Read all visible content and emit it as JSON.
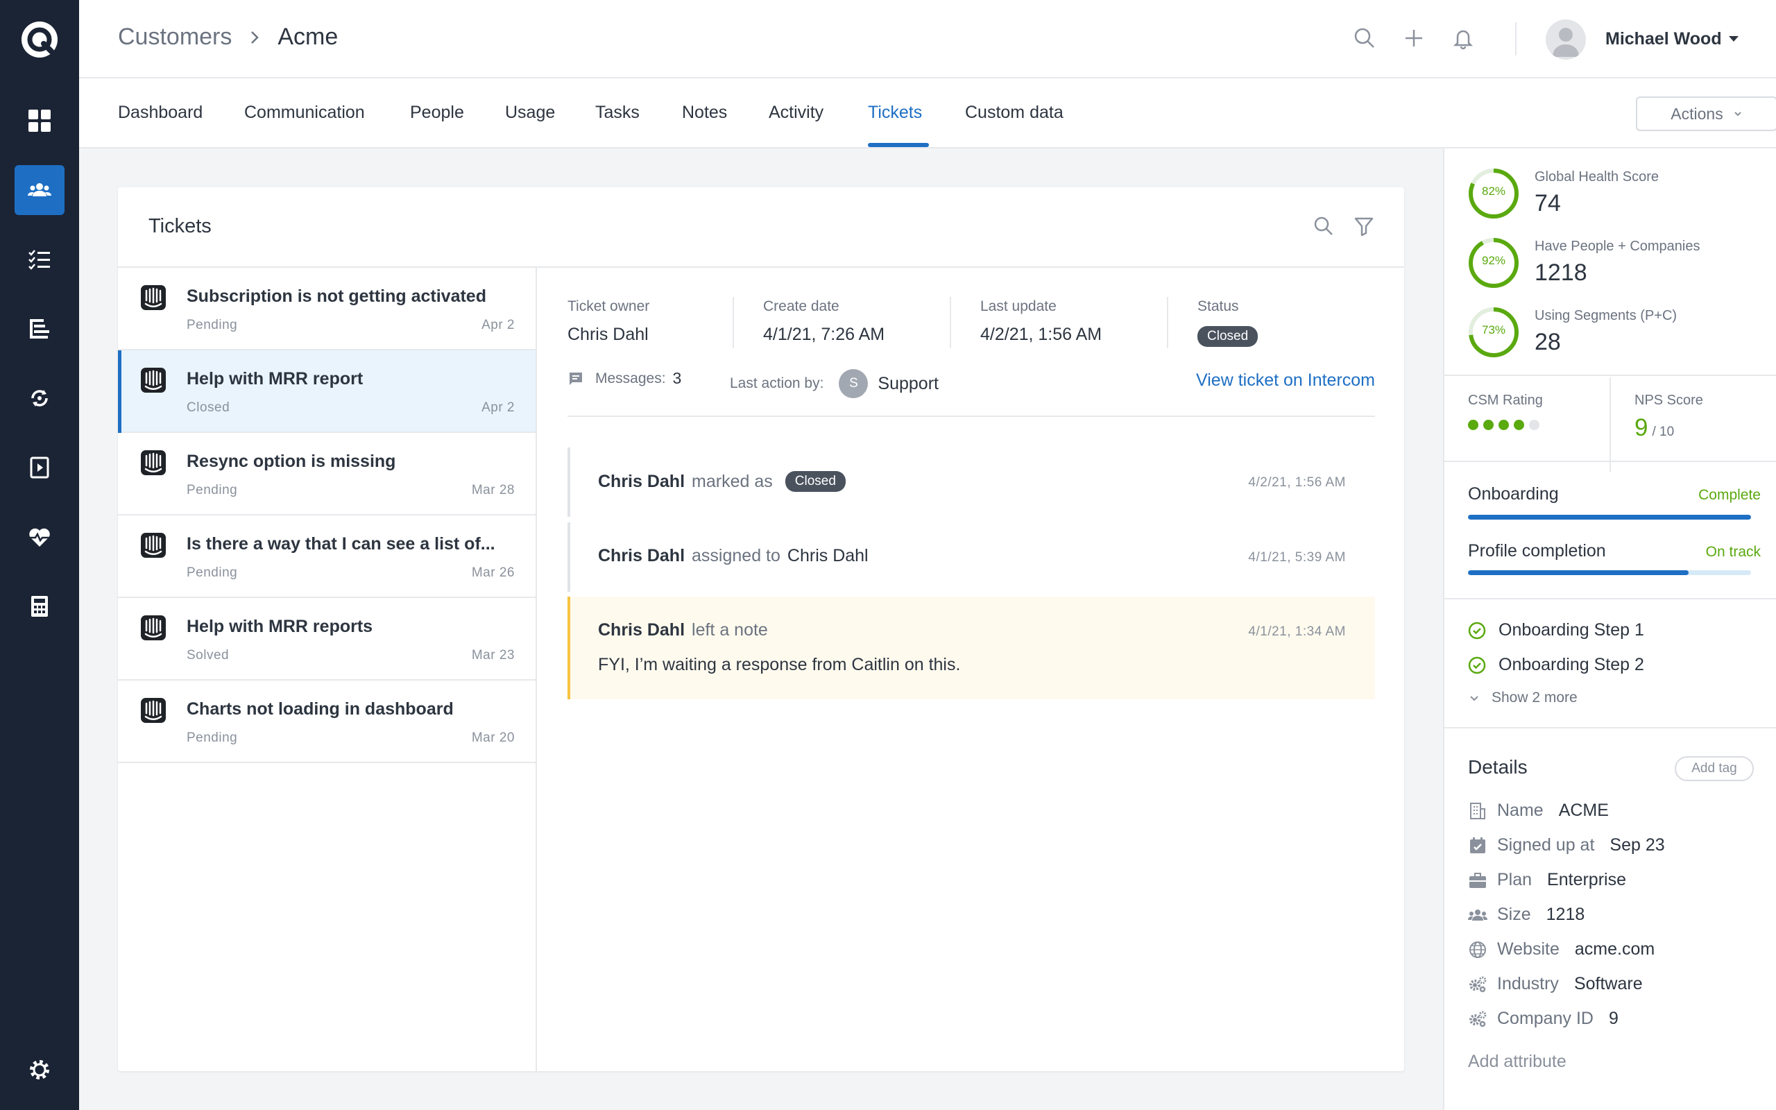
{
  "breadcrumb": {
    "parent": "Customers",
    "current": "Acme"
  },
  "user": {
    "name": "Michael Wood"
  },
  "tabs": [
    {
      "label": "Dashboard"
    },
    {
      "label": "Communication"
    },
    {
      "label": "People"
    },
    {
      "label": "Usage"
    },
    {
      "label": "Tasks"
    },
    {
      "label": "Notes"
    },
    {
      "label": "Activity"
    },
    {
      "label": "Tickets"
    },
    {
      "label": "Custom data"
    }
  ],
  "active_tab": "Tickets",
  "actions_label": "Actions",
  "tickets_card": {
    "title": "Tickets"
  },
  "tickets": [
    {
      "title": "Subscription is not getting activated",
      "status": "Pending",
      "date": "Apr 2"
    },
    {
      "title": "Help with MRR report",
      "status": "Closed",
      "date": "Apr 2"
    },
    {
      "title": "Resync option is missing",
      "status": "Pending",
      "date": "Mar 28"
    },
    {
      "title": "Is there a way that I can see a list of...",
      "status": "Pending",
      "date": "Mar 26"
    },
    {
      "title": "Help with MRR reports",
      "status": "Solved",
      "date": "Mar 23"
    },
    {
      "title": "Charts not loading in dashboard",
      "status": "Pending",
      "date": "Mar 20"
    }
  ],
  "ticket_detail": {
    "owner_label": "Ticket owner",
    "owner": "Chris Dahl",
    "create_label": "Create date",
    "create": "4/1/21, 7:26 AM",
    "update_label": "Last update",
    "update": "4/2/21, 1:56 AM",
    "status_label": "Status",
    "status": "Closed",
    "messages_label": "Messages:",
    "messages": "3",
    "last_action_label": "Last action by:",
    "last_action_initial": "S",
    "last_action_by": "Support",
    "view_link": "View ticket on Intercom"
  },
  "events": [
    {
      "actor": "Chris Dahl",
      "action": "marked as",
      "badge": "Closed",
      "time": "4/2/21, 1:56 AM"
    },
    {
      "actor": "Chris Dahl",
      "action": "assigned to",
      "target": "Chris Dahl",
      "time": "4/1/21, 5:39 AM"
    },
    {
      "actor": "Chris Dahl",
      "action": "left a note",
      "time": "4/1/21, 1:34 AM",
      "note": "FYI, I’m waiting a response from  Caitlin on this."
    }
  ],
  "scores": [
    {
      "pct": "82%",
      "fraction": 0.82,
      "label": "Global Health Score",
      "value": "74"
    },
    {
      "pct": "92%",
      "fraction": 0.92,
      "label": "Have People + Companies",
      "value": "1218"
    },
    {
      "pct": "73%",
      "fraction": 0.73,
      "label": "Using Segments (P+C)",
      "value": "28"
    }
  ],
  "csm": {
    "label": "CSM Rating",
    "rating": 4,
    "max": 5
  },
  "nps": {
    "label": "NPS Score",
    "value": "9",
    "max": "/ 10"
  },
  "progress": [
    {
      "label": "Onboarding",
      "status": "Complete",
      "fraction": 1.0
    },
    {
      "label": "Profile completion",
      "status": "On track",
      "fraction": 0.78
    }
  ],
  "steps": [
    {
      "label": "Onboarding Step 1"
    },
    {
      "label": "Onboarding Step 2"
    }
  ],
  "show_more": "Show 2 more",
  "details": {
    "title": "Details",
    "add_tag": "Add tag",
    "add_attribute": "Add attribute",
    "attrs": [
      {
        "key": "Name",
        "value": "ACME"
      },
      {
        "key": "Signed up at",
        "value": "Sep 23"
      },
      {
        "key": "Plan",
        "value": "Enterprise"
      },
      {
        "key": "Size",
        "value": "1218"
      },
      {
        "key": "Website",
        "value": "acme.com"
      },
      {
        "key": "Industry",
        "value": "Software"
      },
      {
        "key": "Company ID",
        "value": "9"
      }
    ]
  },
  "colors": {
    "accent": "#1e6fc4",
    "sidebar": "#1b2434",
    "success": "#5aa90f",
    "note_bg": "#fffaee",
    "note_border": "#f6c343"
  }
}
